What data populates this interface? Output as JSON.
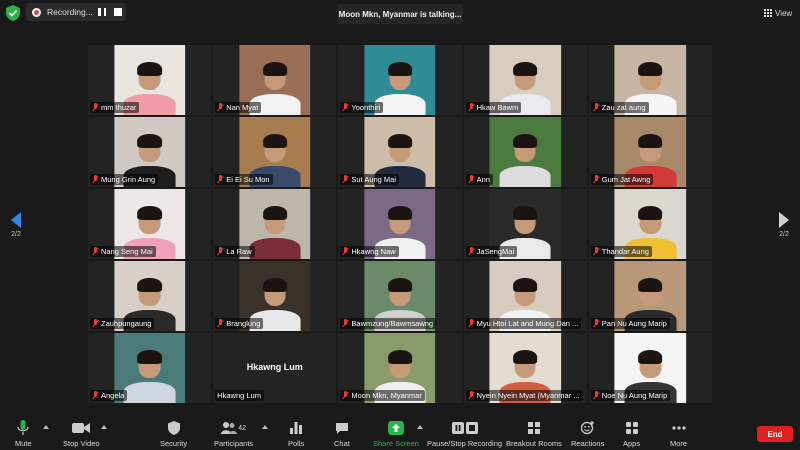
{
  "top": {
    "recording": "Recording...",
    "talking": "Moon Mkn, Myanmar is talking...",
    "view": "View"
  },
  "page_indicator": "2/2",
  "tiles": [
    {
      "name": "mm thuzar",
      "bg": "#e8e4e0",
      "body": "#f19aa8"
    },
    {
      "name": "Nan Myat",
      "bg": "#9a6d55",
      "body": "#f2f2f2"
    },
    {
      "name": "Yoonthiri",
      "bg": "#2e8c96",
      "body": "#f4f4f4"
    },
    {
      "name": "Hkaw Bawm",
      "bg": "#d8cec0",
      "body": "#e9e9ee"
    },
    {
      "name": "Zau zat aung",
      "bg": "#c8b6a4",
      "body": "#f5f5f5"
    },
    {
      "name": "Mung Grin Aung",
      "bg": "#d0c8c2",
      "body": "#1e1e1e"
    },
    {
      "name": "Ei Ei Su Mon",
      "bg": "#a77c4f",
      "body": "#3a4a6a"
    },
    {
      "name": "Sut Aung Mai",
      "bg": "#cdbda8",
      "body": "#222a40"
    },
    {
      "name": "Ann",
      "bg": "#4d7a3f",
      "body": "#dcdcdc"
    },
    {
      "name": "Gum Jat Awng",
      "bg": "#a88a6a",
      "body": "#d23a3a"
    },
    {
      "name": "Nang Seng Mai",
      "bg": "#ece6e6",
      "body": "#f0a0b8"
    },
    {
      "name": "La Raw",
      "bg": "#bfb6aa",
      "body": "#7a2e3a"
    },
    {
      "name": "Hkawng Naw",
      "bg": "#7a6a86",
      "body": "#f0f0f0"
    },
    {
      "name": "JaSengMai",
      "bg": "#2a2a2a",
      "body": "#eaeaea"
    },
    {
      "name": "Thandar Aung",
      "bg": "#dcd6d0",
      "body": "#f0c030"
    },
    {
      "name": "Zauhpungaung",
      "bg": "#d8d0c8",
      "body": "#2a2a2a"
    },
    {
      "name": "Branglung",
      "bg": "#3a3228",
      "body": "#e8e8e8"
    },
    {
      "name": "Bawmzung/Bawmsawng",
      "bg": "#6a8a6a",
      "body": "#cfcfcf"
    },
    {
      "name": "Myu Htoi Lat and Mung Dan ...",
      "bg": "#d8ccc0",
      "body": "#f2f2f2"
    },
    {
      "name": "Pan Nu Aung Marip",
      "bg": "#b89878",
      "body": "#2a2a2a"
    },
    {
      "name": "Angela",
      "bg": "#4a7a7a",
      "body": "#cfd6e0"
    },
    {
      "name": "Hkawng Lum",
      "big_name": "Hkawng Lum"
    },
    {
      "name": "Moon Mkn, Myanmar",
      "bg": "#8a9a6a",
      "body": "#efefef"
    },
    {
      "name": "Nyein Nyein Myat (Myanmar ...",
      "bg": "#e4dcd0",
      "body": "#d06040"
    },
    {
      "name": "Noe Nu Aung Marip",
      "bg": "#f4f4f4",
      "body": "#333333"
    }
  ],
  "toolbar": {
    "mute": "Mute",
    "stop_video": "Stop Video",
    "security": "Security",
    "participants": "Participants",
    "participants_count": "42",
    "polls": "Polls",
    "chat": "Chat",
    "share_screen": "Share Screen",
    "recording": "Pause/Stop Recording",
    "breakout": "Breakout Rooms",
    "reactions": "Reactions",
    "apps": "Apps",
    "more": "More",
    "end": "End"
  },
  "colors": {
    "share_green": "#2bb24c",
    "end_red": "#e0201f",
    "mic_off_red": "#ea3a3a",
    "nav_blue": "#2f87e8"
  }
}
